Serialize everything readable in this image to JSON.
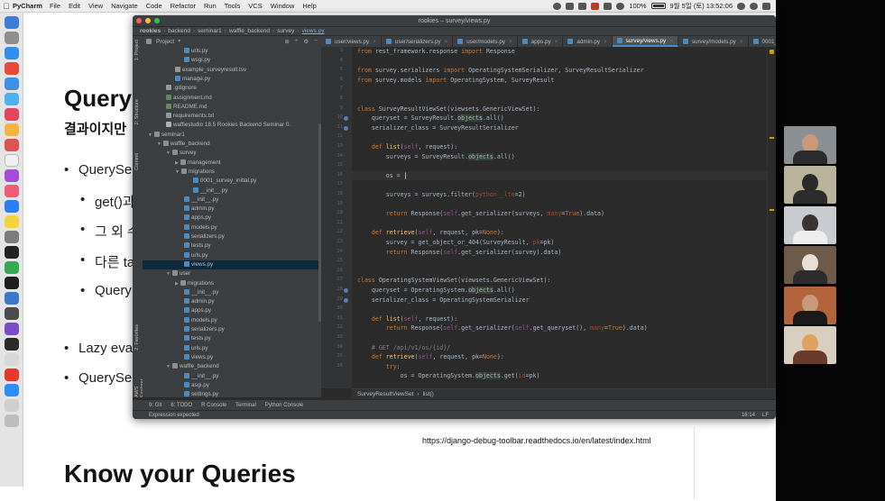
{
  "menubar": {
    "app_name": "PyCharm",
    "items": [
      "File",
      "Edit",
      "View",
      "Navigate",
      "Code",
      "Refactor",
      "Run",
      "Tools",
      "VCS",
      "Window",
      "Help"
    ],
    "battery": "100%",
    "clock": "9월 5일 (토) 13:52:06"
  },
  "slide": {
    "title": "Query",
    "subtitle": "결과이지만",
    "bullets": [
      "QuerySe",
      "get()과",
      "그 외 수",
      "다른 ta",
      "Query",
      "Lazy eva",
      "QuerySe"
    ],
    "link": "https://django-debug-toolbar.readthedocs.io/en/latest/index.html",
    "heading2": "Know your Queries"
  },
  "window": {
    "title": "rookies – survey/views.py",
    "breadcrumb": [
      "rookies",
      "backend",
      "seminar1",
      "waffle_backend",
      "survey",
      "views.py"
    ],
    "project_header": "Project",
    "left_tabs": [
      "1: Project",
      "2: Structure",
      "Commit",
      "2: Favorites",
      "AWS Explorer"
    ]
  },
  "tree": [
    {
      "label": "urls.py",
      "kind": "py",
      "indent": 5
    },
    {
      "label": "wsgi.py",
      "kind": "py",
      "indent": 5
    },
    {
      "label": "example_surveyresult.tsv",
      "kind": "txt",
      "indent": 4
    },
    {
      "label": "manage.py",
      "kind": "py",
      "indent": 4
    },
    {
      "label": ".gitignore",
      "kind": "txt",
      "indent": 3
    },
    {
      "label": "assignment.md",
      "kind": "md",
      "indent": 3
    },
    {
      "label": "README.md",
      "kind": "md",
      "indent": 3
    },
    {
      "label": "requirements.txt",
      "kind": "txt",
      "indent": 3
    },
    {
      "label": "waffiestudio 18.5 Rookies Backend Seminar 0.",
      "kind": "pdf",
      "indent": 3
    },
    {
      "label": "seminar1",
      "kind": "dir",
      "indent": 1,
      "arrow": "▼"
    },
    {
      "label": "waffle_backend",
      "kind": "dir",
      "indent": 2,
      "arrow": "▼"
    },
    {
      "label": "survey",
      "kind": "dir",
      "indent": 3,
      "arrow": "▼"
    },
    {
      "label": "management",
      "kind": "dir",
      "indent": 4,
      "arrow": "▶"
    },
    {
      "label": "migrations",
      "kind": "dir",
      "indent": 4,
      "arrow": "▼"
    },
    {
      "label": "0001_survey_initial.py",
      "kind": "py",
      "indent": 6
    },
    {
      "label": "__init__.py",
      "kind": "py",
      "indent": 6
    },
    {
      "label": "__init__.py",
      "kind": "py",
      "indent": 5
    },
    {
      "label": "admin.py",
      "kind": "py",
      "indent": 5
    },
    {
      "label": "apps.py",
      "kind": "py",
      "indent": 5
    },
    {
      "label": "models.py",
      "kind": "py",
      "indent": 5
    },
    {
      "label": "serializers.py",
      "kind": "py",
      "indent": 5
    },
    {
      "label": "tests.py",
      "kind": "py",
      "indent": 5
    },
    {
      "label": "urls.py",
      "kind": "py",
      "indent": 5
    },
    {
      "label": "views.py",
      "kind": "py",
      "indent": 5,
      "selected": true
    },
    {
      "label": "user",
      "kind": "dir",
      "indent": 3,
      "arrow": "▼"
    },
    {
      "label": "migrations",
      "kind": "dir",
      "indent": 4,
      "arrow": "▶"
    },
    {
      "label": "__init__.py",
      "kind": "py",
      "indent": 5
    },
    {
      "label": "admin.py",
      "kind": "py",
      "indent": 5
    },
    {
      "label": "apps.py",
      "kind": "py",
      "indent": 5
    },
    {
      "label": "models.py",
      "kind": "py",
      "indent": 5
    },
    {
      "label": "serializers.py",
      "kind": "py",
      "indent": 5
    },
    {
      "label": "tests.py",
      "kind": "py",
      "indent": 5
    },
    {
      "label": "urls.py",
      "kind": "py",
      "indent": 5
    },
    {
      "label": "views.py",
      "kind": "py",
      "indent": 5
    },
    {
      "label": "waffle_backend",
      "kind": "dir",
      "indent": 3,
      "arrow": "▼"
    },
    {
      "label": "__init__.py",
      "kind": "py",
      "indent": 5
    },
    {
      "label": "asgi.py",
      "kind": "py",
      "indent": 5
    },
    {
      "label": "settings.py",
      "kind": "py",
      "indent": 5
    }
  ],
  "tabs": [
    {
      "label": "user/views.py",
      "active": false
    },
    {
      "label": "user/serializers.py",
      "active": false
    },
    {
      "label": "user/models.py",
      "active": false
    },
    {
      "label": "apps.py",
      "active": false
    },
    {
      "label": "admin.py",
      "active": false
    },
    {
      "label": "survey/views.py",
      "active": true
    },
    {
      "label": "survey/models.py",
      "active": false
    },
    {
      "label": "0001_survey_",
      "active": false
    }
  ],
  "line_numbers": [
    "3",
    "4",
    "5",
    "6",
    "7",
    "8",
    "9",
    "10",
    "11",
    "12",
    "13",
    "14",
    "15",
    "16",
    "17",
    "18",
    "19",
    "20",
    "21",
    "22",
    "23",
    "24",
    "25",
    "26",
    "27",
    "28",
    "29",
    "30",
    "31",
    "32",
    "33",
    "34",
    "35",
    "36"
  ],
  "code_lines": [
    [
      {
        "t": "from ",
        "c": "kw"
      },
      {
        "t": "rest_framework.response ",
        "c": "p"
      },
      {
        "t": "import ",
        "c": "kw"
      },
      {
        "t": "Response",
        "c": "p"
      }
    ],
    [],
    [
      {
        "t": "from ",
        "c": "kw"
      },
      {
        "t": "survey.serializers ",
        "c": "p"
      },
      {
        "t": "import ",
        "c": "kw"
      },
      {
        "t": "OperatingSystemSerializer, SurveyResultSerializer",
        "c": "p"
      }
    ],
    [
      {
        "t": "from ",
        "c": "kw"
      },
      {
        "t": "survey.models ",
        "c": "p"
      },
      {
        "t": "import ",
        "c": "kw"
      },
      {
        "t": "OperatingSystem, SurveyResult",
        "c": "p"
      }
    ],
    [],
    [],
    [
      {
        "t": "class ",
        "c": "kw"
      },
      {
        "t": "SurveyResultViewSet(viewsets.GenericViewSet):",
        "c": "p"
      }
    ],
    [
      {
        "t": "    queryset = SurveyResult.",
        "c": "p"
      },
      {
        "t": "objects",
        "c": "hl"
      },
      {
        "t": ".all()",
        "c": "p"
      }
    ],
    [
      {
        "t": "    serializer_class = SurveyResultSerializer",
        "c": "p"
      }
    ],
    [],
    [
      {
        "t": "    def ",
        "c": "kw"
      },
      {
        "t": "list",
        "c": "fn"
      },
      {
        "t": "(",
        "c": "p"
      },
      {
        "t": "self",
        "c": "self"
      },
      {
        "t": ", request):",
        "c": "p"
      }
    ],
    [
      {
        "t": "        surveys = SurveyResult.",
        "c": "p"
      },
      {
        "t": "objects",
        "c": "hl"
      },
      {
        "t": ".all()",
        "c": "p"
      }
    ],
    [],
    [
      {
        "t": "        os = ",
        "c": "p"
      },
      {
        "t": "|",
        "c": "cur"
      }
    ],
    [],
    [
      {
        "t": "        surveys = surveys.filter(",
        "c": "p"
      },
      {
        "t": "python__lte",
        "c": "arg"
      },
      {
        "t": "=2)",
        "c": "p"
      }
    ],
    [],
    [
      {
        "t": "        return ",
        "c": "kw"
      },
      {
        "t": "Response(",
        "c": "p"
      },
      {
        "t": "self",
        "c": "self"
      },
      {
        "t": ".get_serializer(surveys, ",
        "c": "p"
      },
      {
        "t": "many",
        "c": "arg"
      },
      {
        "t": "=",
        "c": "p"
      },
      {
        "t": "True",
        "c": "kw"
      },
      {
        "t": ").data)",
        "c": "p"
      }
    ],
    [],
    [
      {
        "t": "    def ",
        "c": "kw"
      },
      {
        "t": "retrieve",
        "c": "fn"
      },
      {
        "t": "(",
        "c": "p"
      },
      {
        "t": "self",
        "c": "self"
      },
      {
        "t": ", request, pk=",
        "c": "p"
      },
      {
        "t": "None",
        "c": "kw"
      },
      {
        "t": "):",
        "c": "p"
      }
    ],
    [
      {
        "t": "        survey = get_object_or_404(SurveyResult, ",
        "c": "p"
      },
      {
        "t": "pk",
        "c": "arg"
      },
      {
        "t": "=pk)",
        "c": "p"
      }
    ],
    [
      {
        "t": "        return ",
        "c": "kw"
      },
      {
        "t": "Response(",
        "c": "p"
      },
      {
        "t": "self",
        "c": "self"
      },
      {
        "t": ".get_serializer(survey).data)",
        "c": "p"
      }
    ],
    [],
    [],
    [
      {
        "t": "class ",
        "c": "kw"
      },
      {
        "t": "OperatingSystemViewSet(viewsets.GenericViewSet):",
        "c": "p"
      }
    ],
    [
      {
        "t": "    queryset = OperatingSystem.",
        "c": "p"
      },
      {
        "t": "objects",
        "c": "hl"
      },
      {
        "t": ".all()",
        "c": "p"
      }
    ],
    [
      {
        "t": "    serializer_class = OperatingSystemSerializer",
        "c": "p"
      }
    ],
    [],
    [
      {
        "t": "    def ",
        "c": "kw"
      },
      {
        "t": "list",
        "c": "fn"
      },
      {
        "t": "(",
        "c": "p"
      },
      {
        "t": "self",
        "c": "self"
      },
      {
        "t": ", request):",
        "c": "p"
      }
    ],
    [
      {
        "t": "        return ",
        "c": "kw"
      },
      {
        "t": "Response(",
        "c": "p"
      },
      {
        "t": "self",
        "c": "self"
      },
      {
        "t": ".get_serializer(",
        "c": "p"
      },
      {
        "t": "self",
        "c": "self"
      },
      {
        "t": ".get_queryset(), ",
        "c": "p"
      },
      {
        "t": "many",
        "c": "arg"
      },
      {
        "t": "=",
        "c": "p"
      },
      {
        "t": "True",
        "c": "kw"
      },
      {
        "t": ").data)",
        "c": "p"
      }
    ],
    [],
    [
      {
        "t": "    # GET /api/v1/os/{id}/",
        "c": "cm"
      }
    ],
    [
      {
        "t": "    def ",
        "c": "kw"
      },
      {
        "t": "retrieve",
        "c": "fn"
      },
      {
        "t": "(",
        "c": "p"
      },
      {
        "t": "self",
        "c": "self"
      },
      {
        "t": ", request, pk=",
        "c": "p"
      },
      {
        "t": "None",
        "c": "kw"
      },
      {
        "t": "):",
        "c": "p"
      }
    ],
    [
      {
        "t": "        try",
        "c": "kw"
      },
      {
        "t": ":",
        "c": "p"
      }
    ],
    [
      {
        "t": "            os = OperatingSystem.",
        "c": "p"
      },
      {
        "t": "objects",
        "c": "hl"
      },
      {
        "t": ".get(",
        "c": "p"
      },
      {
        "t": "id",
        "c": "arg"
      },
      {
        "t": "=pk)",
        "c": "p"
      }
    ]
  ],
  "code_breadcrumb": [
    "SurveyResultViewSet",
    "list()"
  ],
  "bottom_tools": [
    "9: Git",
    "6: TODO",
    "R Console",
    "Terminal",
    "Python Console"
  ],
  "status": {
    "message": "Expression expected",
    "position": "16:14",
    "encoding": "LF"
  },
  "colors": {
    "keyword": "#cc7832",
    "plain": "#a9b7c6",
    "function": "#ffc66d",
    "self": "#94558d",
    "arg": "#aa4926",
    "comment": "#808080",
    "highlight_bg": "#344134"
  }
}
